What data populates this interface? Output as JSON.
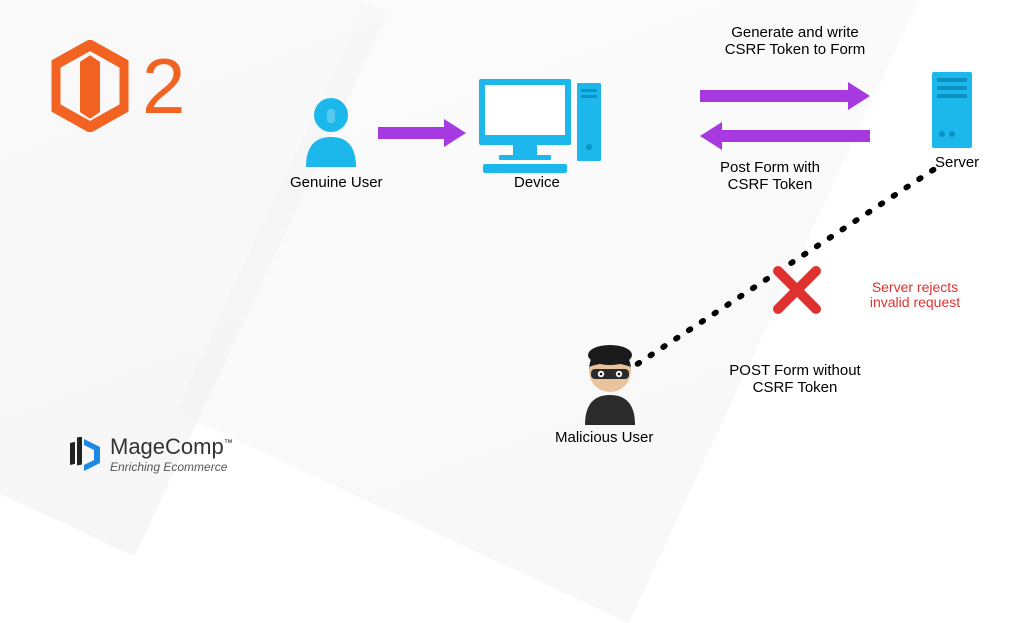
{
  "logo": {
    "version": "2"
  },
  "nodes": {
    "genuine_user": "Genuine User",
    "device": "Device",
    "server": "Server",
    "malicious_user": "Malicious User"
  },
  "edges": {
    "generate": "Generate and write CSRF Token to Form",
    "post_with_token": "Post Form with CSRF Token",
    "post_without_token": "POST Form without CSRF Token",
    "reject": "Server rejects invalid request"
  },
  "company": {
    "name": "MageComp",
    "tagline": "Enriching Ecommerce",
    "tm": "™"
  },
  "colors": {
    "magento_orange": "#f26322",
    "cyan": "#1cb7eb",
    "purple": "#a63ae0",
    "red": "#e03131"
  }
}
